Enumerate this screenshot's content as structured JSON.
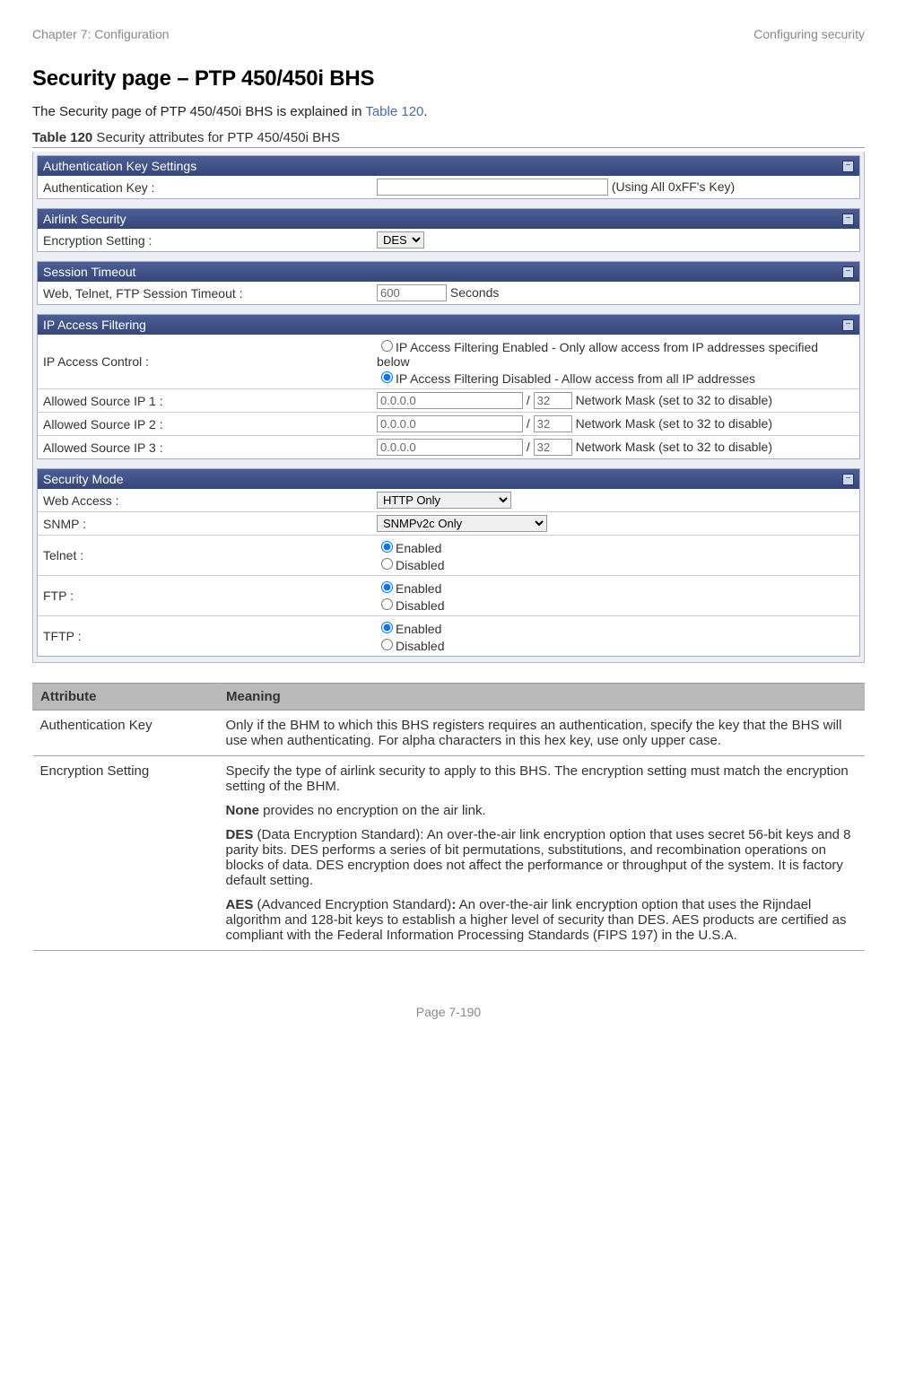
{
  "header": {
    "left": "Chapter 7:  Configuration",
    "right": "Configuring security"
  },
  "title": "Security page – PTP 450/450i BHS",
  "intro_prefix": "The Security page of PTP 450/450i BHS is explained in ",
  "intro_link": "Table 120",
  "intro_suffix": ".",
  "caption_bold": "Table 120",
  "caption_rest": " Security attributes for PTP 450/450i BHS",
  "panels": {
    "auth": {
      "title": "Authentication Key Settings",
      "row1_label": "Authentication Key :",
      "row1_note": "(Using All 0xFF's Key)"
    },
    "airlink": {
      "title": "Airlink Security",
      "row1_label": "Encryption Setting :",
      "row1_select": "DES"
    },
    "session": {
      "title": "Session Timeout",
      "row1_label": "Web, Telnet, FTP Session Timeout :",
      "row1_value": "600",
      "row1_unit": "Seconds"
    },
    "ipfilter": {
      "title": "IP Access Filtering",
      "row_ctrl_label": "IP Access Control :",
      "opt_enabled": "IP Access Filtering Enabled - Only allow access from IP addresses specified below",
      "opt_disabled": "IP Access Filtering Disabled - Allow access from all IP addresses",
      "src1_label": "Allowed Source IP 1 :",
      "src2_label": "Allowed Source IP 2 :",
      "src3_label": "Allowed Source IP 3 :",
      "ip_value": "0.0.0.0",
      "mask_value": "32",
      "mask_note": "Network Mask (set to 32 to disable)"
    },
    "secmode": {
      "title": "Security Mode",
      "web_label": "Web Access :",
      "web_value": "HTTP Only",
      "snmp_label": "SNMP :",
      "snmp_value": "SNMPv2c Only",
      "telnet_label": "Telnet :",
      "ftp_label": "FTP :",
      "tftp_label": "TFTP :",
      "enabled": "Enabled",
      "disabled": "Disabled"
    }
  },
  "attr_table": {
    "col1": "Attribute",
    "col2": "Meaning",
    "r1_attr": "Authentication Key",
    "r1_mean": "Only if the BHM to which this BHS registers requires an authentication, specify the key that the BHS will use when authenticating. For alpha characters in this hex key, use only upper case.",
    "r2_attr": "Encryption Setting",
    "r2_p1": "Specify the type of airlink security to apply to this BHS. The encryption setting must match the encryption setting of the BHM.",
    "r2_p2_b": "None",
    "r2_p2_rest": " provides no encryption on the air link.",
    "r2_p3_b": "DES",
    "r2_p3_rest": " (Data Encryption Standard): An over-the-air link encryption option that uses secret 56-bit keys and 8 parity bits. DES performs a series of bit permutations, substitutions, and recombination operations on blocks of data. DES encryption does not affect the performance or throughput of the system. It is factory default setting.",
    "r2_p4_b": "AES",
    "r2_p4_mid": " (Advanced Encryption Standard)",
    "r2_p4_colon": ":",
    "r2_p4_rest": " An over-the-air link encryption option that uses the Rijndael algorithm and 128-bit keys to establish a higher level of security than DES. AES products are certified as compliant with the Federal Information Processing Standards (FIPS 197) in the U.S.A."
  },
  "footer": "Page 7-190"
}
